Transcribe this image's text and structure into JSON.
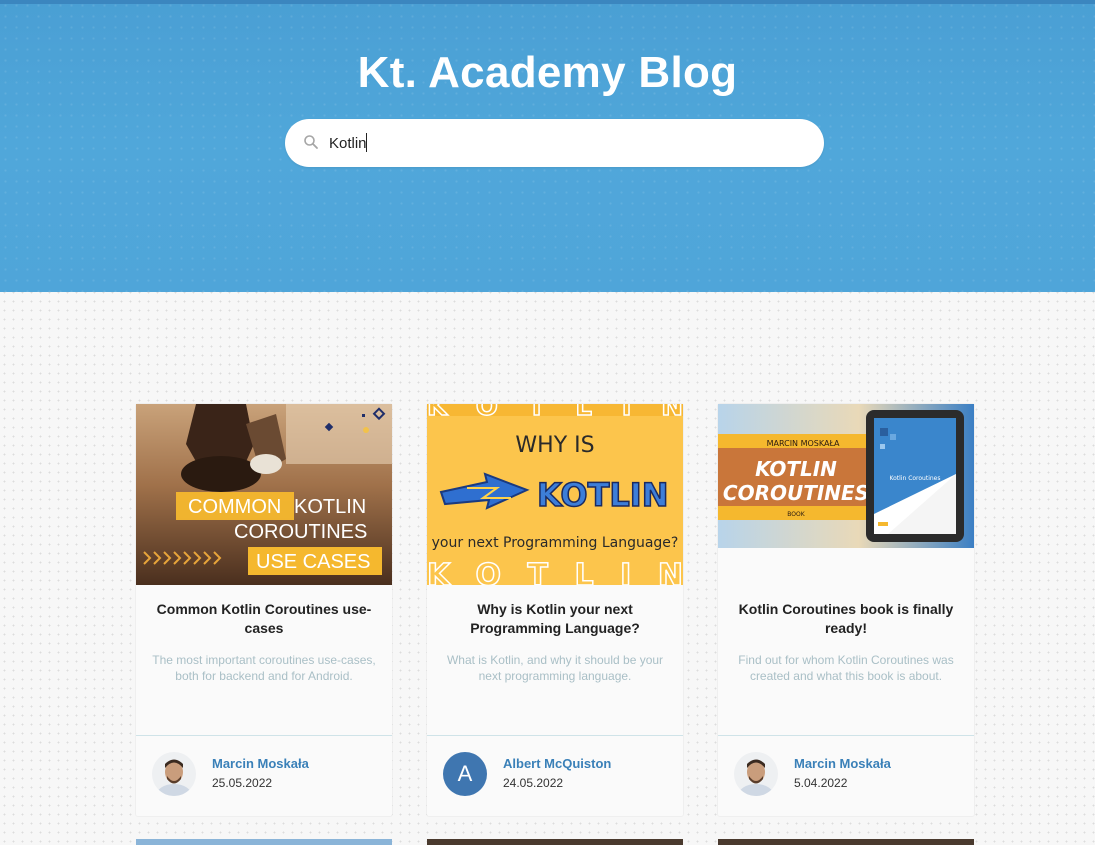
{
  "header": {
    "title": "Kt. Academy Blog"
  },
  "search": {
    "value": "Kotlin",
    "icon": "search-icon"
  },
  "posts": [
    {
      "title": "Common Kotlin Coroutines use-cases",
      "description": "The most important coroutines use-cases, both for backend and for Android.",
      "author": "Marcin Moskała",
      "date": "25.05.2022",
      "image": {
        "line1a": "COMMON",
        "line1b": "KOTLIN",
        "line2": "COROUTINES",
        "line3": "USE CASES"
      }
    },
    {
      "title": "Why is Kotlin your next Programming Language?",
      "description": "What is Kotlin, and why it should be your next programming language.",
      "author": "Albert McQuiston",
      "avatar_letter": "A",
      "date": "24.05.2022",
      "image": {
        "top": "WHY IS",
        "word": "KOTLIN",
        "bottom": "your next Programming Language?"
      }
    },
    {
      "title": "Kotlin Coroutines book is finally ready!",
      "description": "Find out for whom Kotlin Coroutines was created and what this book is about.",
      "author": "Marcin Moskała",
      "date": "5.04.2022",
      "image": {
        "author": "MARCIN MOSKAŁA",
        "line1": "KOTLIN",
        "line2": "COROUTINES",
        "label": "BOOK",
        "tablet_title": "Kotlin Coroutines"
      }
    }
  ],
  "colors": {
    "hero": "#4fa5d9",
    "accent": "#3a80b8",
    "yellow": "#f9c34a"
  }
}
